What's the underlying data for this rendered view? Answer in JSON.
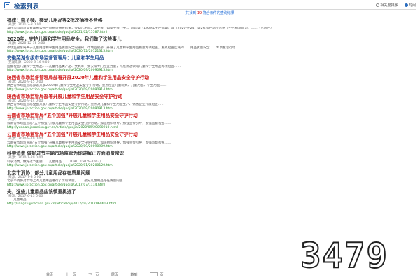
{
  "header": {
    "title": "检索列表",
    "radio_related": "相关度排序",
    "radio_time": "时间"
  },
  "summary": {
    "prefix": "共找到",
    "count": "19",
    "suffix": "符合条件的查询结果"
  },
  "results": [
    {
      "title": "福建：电子琴、婴幼儿用品等2批次抽检不合格",
      "style": "dark",
      "meta": "来源：2021-2-8 0:00",
      "snip": "漳州市市场监督管理局公布产品质量抽查结果，婴幼儿用品、电子琴（如电子琴（中）、玩具等（1959年生产日期）等（2020-9-24）等2批次产品不合格（不合格项目为：……（见附件）",
      "url": "http://www.jpraction.gov.cn/article/guojia/2021/02/15587.html"
    },
    {
      "title": "2020年，守护儿童和学生用品安全，我们做了这些事儿",
      "style": "dark",
      "meta": "来源：2020-12-16 0:00",
      "snip": "市场监管总局关于儿童用品和学生用品质量安全的通知，市场监管部门开展了儿童和学生用品质量专项检查，重点检查区域的……用品质量安全……专项整治行动……",
      "url": "http://www.jpraction.gov.cn/article/guojia/2020/12/20121315.html"
    },
    {
      "title": "安徽芜湖省级市场监督管理局：儿童和学生用品",
      "style": "blue",
      "meta": "芜湖来源：2020-9-16 0:00",
      "snip": "监督检查儿童和学生用品……儿童用品类产品、文具等，要安排专门检查力量，开展流通领域儿童和学生用品专项检查……",
      "url": "http://www.jpraction.gov.cn/article/guojia/2020/09/20090915.html"
    },
    {
      "title": "陕西省市场监督管理局部署开展2020年儿童和学生用品安全守护行动",
      "style": "red",
      "meta": "来源：2020-9-15 0:00",
      "snip": "陕西省市场监管局部署开展2020年儿童和学生用品安全守护行动，重点检查儿童玩具、儿童用品、学生用品……",
      "url": "http://www.jpraction.gov.cn/article/guojia/2020/09/20090914.html"
    },
    {
      "title": "陕西省市场监管局部署开展儿童和学生用品安全守护行动",
      "style": "red",
      "meta": "来源：2020-9-14 0:00",
      "snip": "陕西省市场监管局全面开展儿童和学生用品安全守护行动，重点对儿童和学生用品生产、销售企业开展检查……",
      "url": "http://www.jpraction.gov.cn/article/guojia/2020/09/20090913.html"
    },
    {
      "title": "云南省市场监管局“五个加强”开展儿童和学生用品安全守护行动",
      "style": "red",
      "meta": "来源：2020-9-10 0:00",
      "snip": "云南省市场监管局“五个加强”开展儿童和学生用品安全守护行动，加强组织领导，加强宣传引导，加强监督检查……",
      "url": "http://yunnan.jpraction.gov.cn/article/guojia/2020/09/20090910.html"
    },
    {
      "title": "云南省市场监管局“五个加强”开展儿童和学生用品安全守护行动",
      "style": "red",
      "meta": "来源：2020-9-10 0:00",
      "snip": "云南省市场监管局“五个加强”开展儿童和学生用品安全守护行动，加强组织领导，加强宣传引导，加强监督检查……",
      "url": "http://www.jpraction.gov.cn/article/guojia/2020/09/20090909.html"
    },
    {
      "title": "科学消费 做好过节主题市场监管为你讲解正方面消费常识",
      "style": "dark",
      "meta": "来源：2020-1-20 0:00",
      "snip": "科学消费，做好过节主题……儿童用品……（GB/T 15079-2002）……",
      "url": "http://www.jpraction.gov.cn/article/guojia/2020/01/20200120.html"
    },
    {
      "title": "北京市消协：部分儿童用品存在质量问题",
      "style": "dark",
      "meta": "来源：2017-7-3 0:00",
      "snip": "北京市消协对市场上的儿童用品进行了比较试验，……部分儿童用品存在质量问题……",
      "url": "http://www.jpraction.gov.cn/article/guojia/2017/07/1114.html"
    },
    {
      "title": "夹，这些儿童用品应该慎重挑选了",
      "style": "dark",
      "meta": "来源：2017-6-13 0:00",
      "snip": "……儿童用品……",
      "url": "http://jiangsu.jpraction.gov.cn/article/qiji/2017/06/2017060613.html"
    }
  ],
  "overlay_text": "3479",
  "pager": {
    "first": "首页",
    "prev": "上一页",
    "next": "下一页",
    "last": "尾页",
    "goto": "转到",
    "page": "页"
  }
}
